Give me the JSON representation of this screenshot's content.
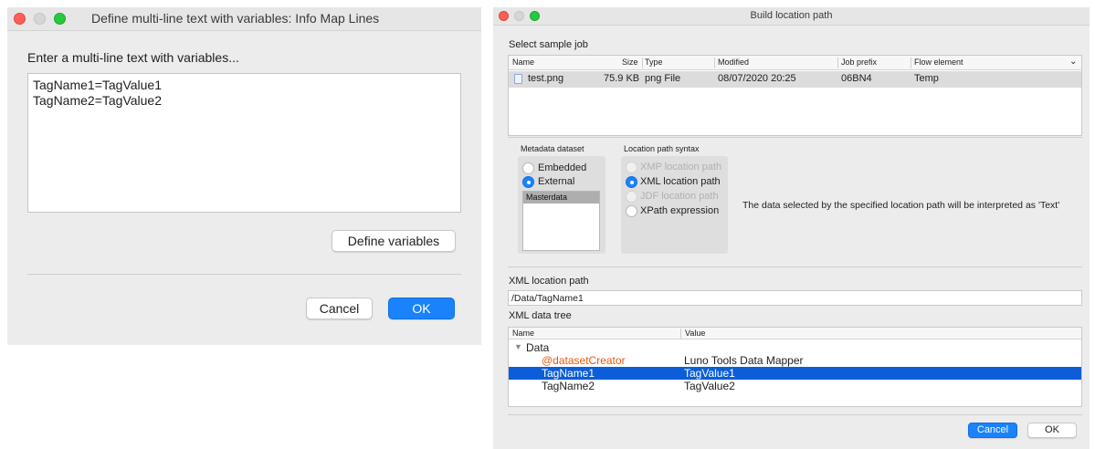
{
  "left_dialog": {
    "title": "Define multi-line text with variables: Info Map Lines",
    "prompt": "Enter a multi-line text with variables...",
    "text_lines": [
      "TagName1=TagValue1",
      "TagName2=TagValue2"
    ],
    "define_variables_label": "Define variables",
    "cancel_label": "Cancel",
    "ok_label": "OK"
  },
  "right_dialog": {
    "title": "Build location path",
    "sample_job_label": "Select sample job",
    "table": {
      "columns": [
        "Name",
        "Size",
        "Type",
        "Modified",
        "Job prefix",
        "Flow element"
      ],
      "rows": [
        {
          "name": "test.png",
          "size": "75.9 KB",
          "type": "png File",
          "modified": "08/07/2020 20:25",
          "job_prefix": "06BN4",
          "flow_element": "Temp"
        }
      ]
    },
    "metadata_dataset": {
      "label": "Metadata dataset",
      "options": [
        "Embedded",
        "External"
      ],
      "selected": "External",
      "list_items": [
        "Masterdata"
      ]
    },
    "location_path_syntax": {
      "label": "Location path syntax",
      "options": [
        {
          "label": "XMP location path",
          "enabled": false
        },
        {
          "label": "XML location path",
          "enabled": true
        },
        {
          "label": "JDF location path",
          "enabled": false
        },
        {
          "label": "XPath expression",
          "enabled": true
        }
      ],
      "selected": "XML location path"
    },
    "interpret_note": "The data selected by the specified location path will be interpreted as 'Text'",
    "xml_location_path_label": "XML location path",
    "xml_location_path_value": "/Data/TagName1",
    "xml_data_tree_label": "XML data tree",
    "tree": {
      "columns": [
        "Name",
        "Value"
      ],
      "root": "Data",
      "rows": [
        {
          "name": "@datasetCreator",
          "value": "Luno Tools Data Mapper",
          "attribute": true,
          "selected": false
        },
        {
          "name": "TagName1",
          "value": "TagValue1",
          "attribute": false,
          "selected": true
        },
        {
          "name": "TagName2",
          "value": "TagValue2",
          "attribute": false,
          "selected": false
        }
      ]
    },
    "cancel_label": "Cancel",
    "ok_label": "OK"
  },
  "colors": {
    "accent": "#1a82fb",
    "selection": "#0b5ed7",
    "attribute_text": "#e8590c",
    "window_bg": "#ececec"
  }
}
